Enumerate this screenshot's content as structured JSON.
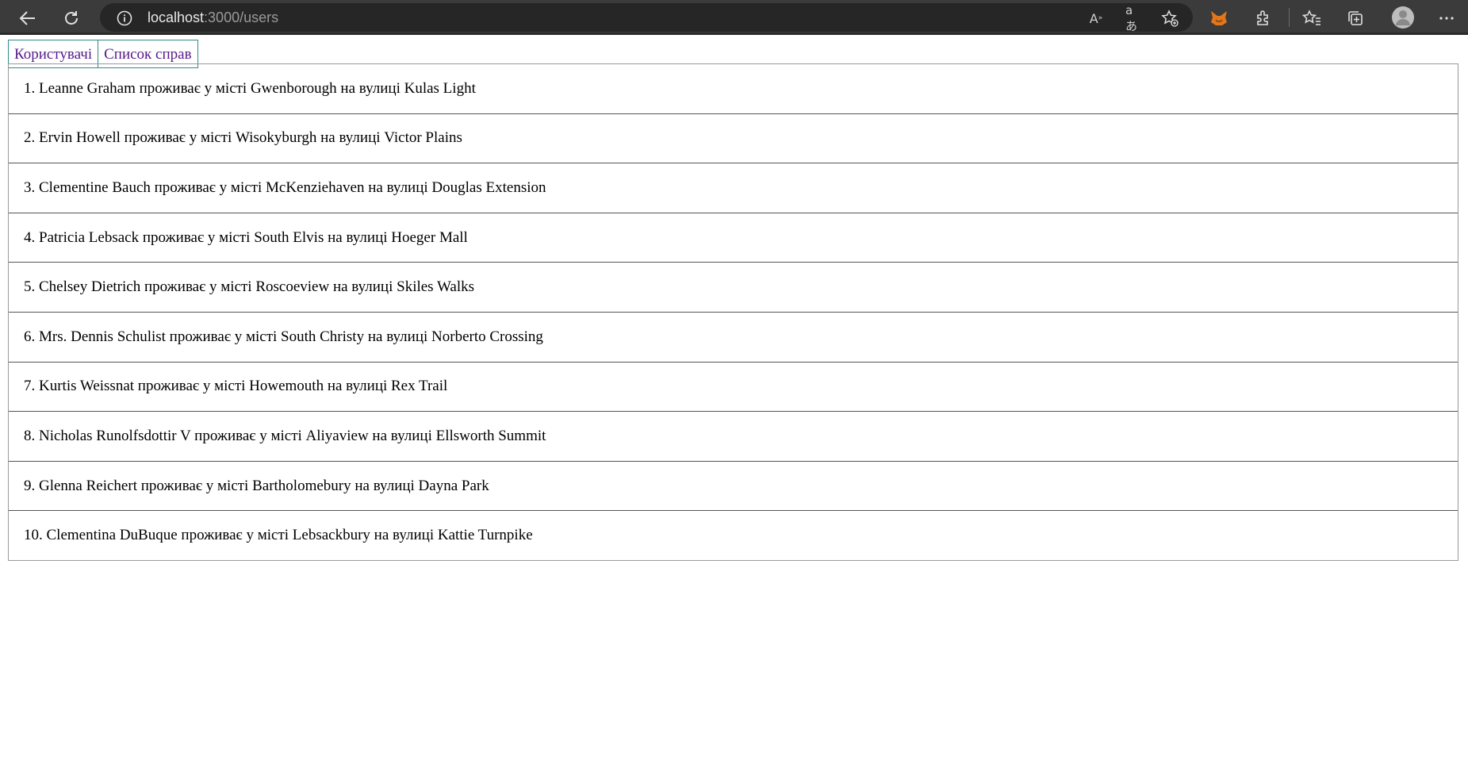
{
  "browser": {
    "url_host": "localhost",
    "url_path": ":3000/users",
    "icons": [
      "back-arrow-icon",
      "reload-icon",
      "site-info-icon",
      "read-aloud-icon",
      "translate-icon",
      "add-favorite-icon",
      "metamask-fox-icon",
      "extensions-icon",
      "favorites-icon",
      "collections-icon",
      "profile-avatar-icon",
      "more-menu-icon"
    ]
  },
  "nav": {
    "users_link": "Користувачі",
    "todos_link": "Список справ"
  },
  "colors": {
    "link": "#551a8b",
    "nav_border": "#2e8b8b",
    "toolbar_bg": "#3b3b3b"
  },
  "users": [
    "1. Leanne Graham проживає у місті Gwenborough на вулиці Kulas Light",
    "2. Ervin Howell проживає у місті Wisokyburgh на вулиці Victor Plains",
    "3. Clementine Bauch проживає у місті McKenziehaven на вулиці Douglas Extension",
    "4. Patricia Lebsack проживає у місті South Elvis на вулиці Hoeger Mall",
    "5. Chelsey Dietrich проживає у місті Roscoeview на вулиці Skiles Walks",
    "6. Mrs. Dennis Schulist проживає у місті South Christy на вулиці Norberto Crossing",
    "7. Kurtis Weissnat проживає у місті Howemouth на вулиці Rex Trail",
    "8. Nicholas Runolfsdottir V проживає у місті Aliyaview на вулиці Ellsworth Summit",
    "9. Glenna Reichert проживає у місті Bartholomebury на вулиці Dayna Park",
    "10. Clementina DuBuque проживає у місті Lebsackbury на вулиці Kattie Turnpike"
  ]
}
